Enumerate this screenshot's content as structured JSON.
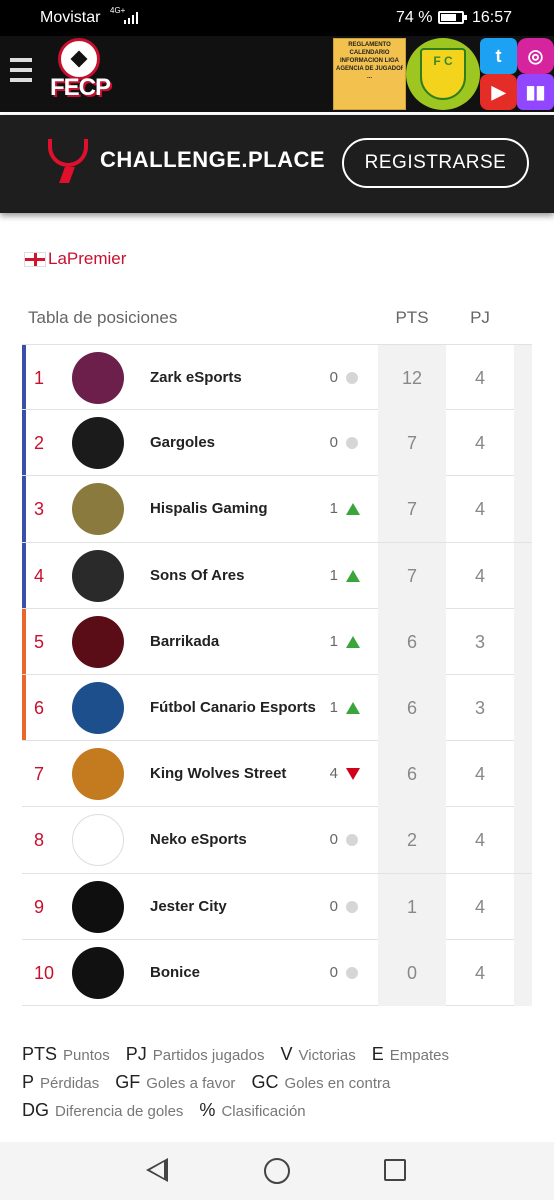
{
  "status_bar": {
    "carrier": "Movistar",
    "network": "4G+",
    "battery": "74 %",
    "battery_level": 0.74,
    "time": "16:57"
  },
  "header": {
    "logo_text": "FECP",
    "menu_note_lines": [
      "REGLAMENTO",
      "CALENDARIO",
      "INFORMACION LIGA",
      "AGENCIA DE JUGADORES",
      "..."
    ],
    "fc_badge_text": "F C",
    "social_icons": [
      "twitter-icon",
      "instagram-icon",
      "youtube-icon",
      "twitch-icon"
    ]
  },
  "challenge_bar": {
    "brand": "CHALLENGE.PLACE",
    "register_label": "REGISTRARSE"
  },
  "league": {
    "name": "LaPremier"
  },
  "table": {
    "title": "Tabla de posiciones",
    "col_pts": "PTS",
    "col_pj": "PJ",
    "rows": [
      {
        "pos": "1",
        "team": "Zark eSports",
        "change": "0",
        "trend": "neutral",
        "pts": "12",
        "pj": "4",
        "zone": "blue",
        "crest_color": "#6b1f4a"
      },
      {
        "pos": "2",
        "team": "Gargoles",
        "change": "0",
        "trend": "neutral",
        "pts": "7",
        "pj": "4",
        "zone": "blue",
        "crest_color": "#1b1b1b"
      },
      {
        "pos": "3",
        "team": "Hispalis Gaming",
        "change": "1",
        "trend": "up",
        "pts": "7",
        "pj": "4",
        "zone": "blue",
        "crest_color": "#8b7a3e"
      },
      {
        "pos": "4",
        "team": "Sons Of Ares",
        "change": "1",
        "trend": "up",
        "pts": "7",
        "pj": "4",
        "zone": "blue",
        "crest_color": "#2a2a2a"
      },
      {
        "pos": "5",
        "team": "Barrikada",
        "change": "1",
        "trend": "up",
        "pts": "6",
        "pj": "3",
        "zone": "orange",
        "crest_color": "#5a0d16"
      },
      {
        "pos": "6",
        "team": "Fútbol Canario Esports",
        "change": "1",
        "trend": "up",
        "pts": "6",
        "pj": "3",
        "zone": "orange",
        "crest_color": "#1d4f8c"
      },
      {
        "pos": "7",
        "team": "King Wolves Street",
        "change": "4",
        "trend": "down",
        "pts": "6",
        "pj": "4",
        "zone": "none",
        "crest_color": "#c47a1e"
      },
      {
        "pos": "8",
        "team": "Neko eSports",
        "change": "0",
        "trend": "neutral",
        "pts": "2",
        "pj": "4",
        "zone": "none",
        "crest_color": "#ffffff"
      },
      {
        "pos": "9",
        "team": "Jester City",
        "change": "0",
        "trend": "neutral",
        "pts": "1",
        "pj": "4",
        "zone": "none",
        "crest_color": "#0f0f0f"
      },
      {
        "pos": "10",
        "team": "Bonice",
        "change": "0",
        "trend": "neutral",
        "pts": "0",
        "pj": "4",
        "zone": "none",
        "crest_color": "#111111"
      }
    ]
  },
  "legend": [
    [
      {
        "abbr": "PTS",
        "desc": "Puntos"
      },
      {
        "abbr": "PJ",
        "desc": "Partidos jugados"
      },
      {
        "abbr": "V",
        "desc": "Victorias"
      },
      {
        "abbr": "E",
        "desc": "Empates"
      }
    ],
    [
      {
        "abbr": "P",
        "desc": "Pérdidas"
      },
      {
        "abbr": "GF",
        "desc": "Goles a favor"
      },
      {
        "abbr": "GC",
        "desc": "Goles en contra"
      }
    ],
    [
      {
        "abbr": "DG",
        "desc": "Diferencia de goles"
      },
      {
        "abbr": "%",
        "desc": "Clasificación"
      }
    ]
  ],
  "colors": {
    "zone_blue": "#3a4fa8",
    "zone_orange": "#e8672a",
    "accent_red": "#c8102e"
  }
}
